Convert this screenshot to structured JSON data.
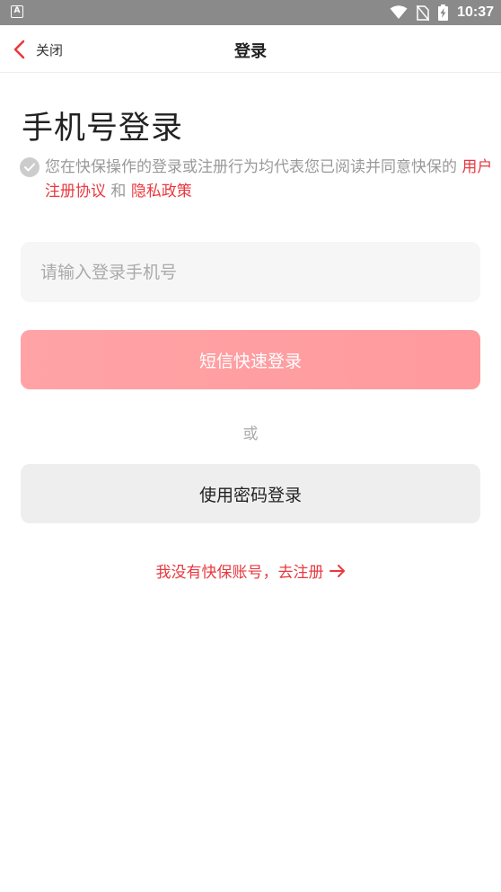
{
  "status_bar": {
    "app_icon_letter": "A",
    "time": "10:37"
  },
  "nav": {
    "back_label": "关闭",
    "title": "登录"
  },
  "main": {
    "title": "手机号登录",
    "agreement": {
      "prefix": "您在快保操作的登录或注册行为均代表您已阅读并同意快保的",
      "user_agreement": "用户注册协议",
      "and": "和",
      "privacy_policy": "隐私政策"
    },
    "phone_input": {
      "placeholder": "请输入登录手机号",
      "value": ""
    },
    "sms_login_label": "短信快速登录",
    "or_label": "或",
    "password_login_label": "使用密码登录",
    "register_link_label": "我没有快保账号，去注册"
  },
  "colors": {
    "accent": "#e8393f",
    "sms_button": "#ff9fa3",
    "status_bar": "#8a8a8a"
  }
}
